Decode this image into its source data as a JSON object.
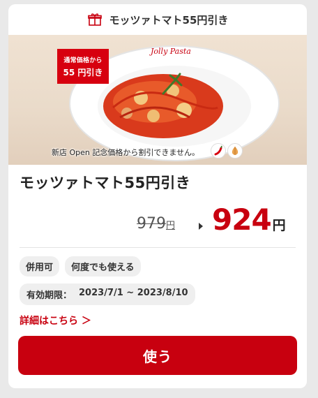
{
  "header": {
    "title": "モッツァトマト55円引き",
    "icon": "gift-icon"
  },
  "hero": {
    "badge_top": "通常価格から",
    "badge_bottom": "55 円引き",
    "caption": "新店 Open 記念価格から割引できません。",
    "logo_text": "Jolly Pasta",
    "icons": [
      "chili-pepper-icon",
      "garlic-icon"
    ]
  },
  "coupon": {
    "title": "モッツァトマト55円引き",
    "old_price": "979",
    "old_unit": "円",
    "new_price": "924",
    "new_unit": "円"
  },
  "tags": [
    "併用可",
    "何度でも使える"
  ],
  "validity": {
    "label": "有効期限：",
    "period": "2023/7/1 ~ 2023/8/10"
  },
  "details_link": "詳細はこちら ＞",
  "use_button": "使う",
  "colors": {
    "accent": "#c8000f",
    "background": "#e9e9e9",
    "chip": "#efefef"
  }
}
